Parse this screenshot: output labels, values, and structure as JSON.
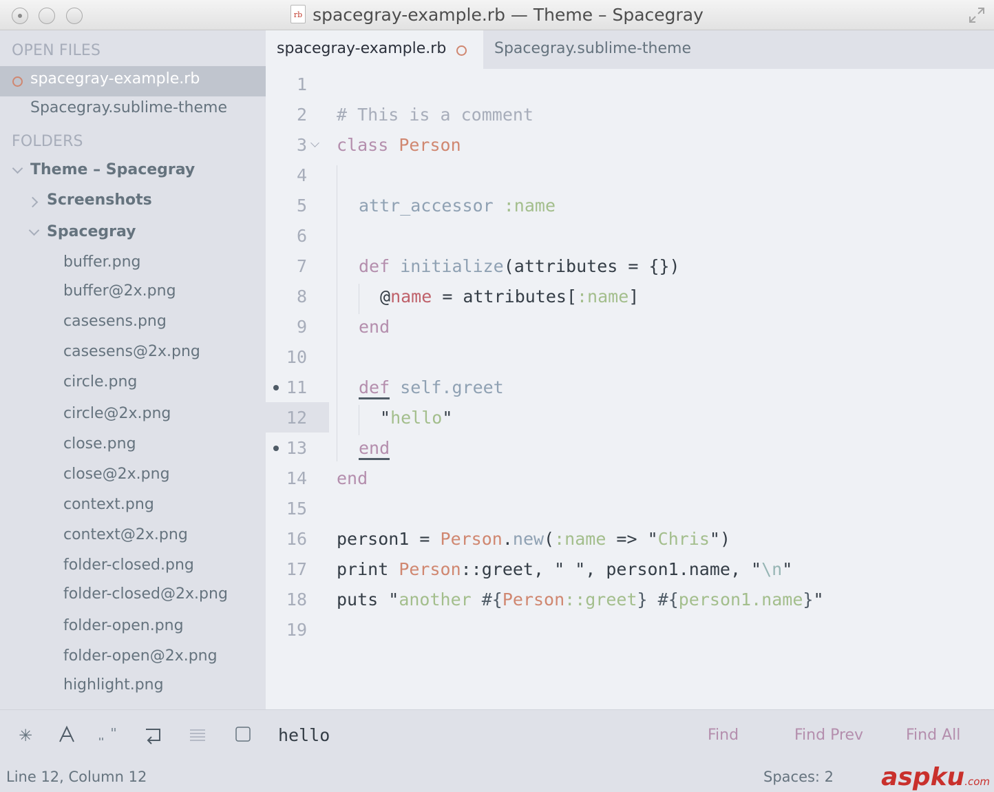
{
  "window": {
    "title": "spacegray-example.rb — Theme – Spacegray",
    "file_icon_label": "rb"
  },
  "sidebar": {
    "open_files_title": "OPEN FILES",
    "open_files": [
      {
        "label": "spacegray-example.rb",
        "active": true,
        "modified": true
      },
      {
        "label": "Spacegray.sublime-theme",
        "active": false,
        "modified": false
      }
    ],
    "folders_title": "FOLDERS",
    "tree": {
      "root": "Theme – Spacegray",
      "screenshots": "Screenshots",
      "spacegray": "Spacegray",
      "files": [
        "buffer.png",
        "buffer@2x.png",
        "casesens.png",
        "casesens@2x.png",
        "circle.png",
        "circle@2x.png",
        "close.png",
        "close@2x.png",
        "context.png",
        "context@2x.png",
        "folder-closed.png",
        "folder-closed@2x.png",
        "folder-open.png",
        "folder-open@2x.png",
        "highlight.png"
      ]
    }
  },
  "tabs": [
    {
      "label": "spacegray-example.rb",
      "active": true,
      "modified": true
    },
    {
      "label": "Spacegray.sublime-theme",
      "active": false,
      "modified": false
    }
  ],
  "editor": {
    "line_numbers": [
      "1",
      "2",
      "3",
      "4",
      "5",
      "6",
      "7",
      "8",
      "9",
      "10",
      "11",
      "12",
      "13",
      "14",
      "15",
      "16",
      "17",
      "18",
      "19"
    ],
    "current_line": 12,
    "comment": "# This is a comment",
    "class_kw": "class",
    "class_name": "Person",
    "attr_accessor": "attr_accessor",
    "sym_name": ":name",
    "def_kw": "def",
    "initialize": "initialize",
    "init_args": "(attributes = {})",
    "ivar_at": "@",
    "ivar_name": "name",
    "assign": " = attributes[",
    "close_bracket": "]",
    "end_kw": "end",
    "self_greet": "self.greet",
    "quote": "\"",
    "hello": "hello",
    "person1_assign": "person1 = ",
    "dot": ".",
    "new": "new",
    "open_paren": "(",
    "arrow": " => ",
    "chris": "Chris",
    "close_paren": "\")",
    "print_kw": "print ",
    "greet_call": "::greet, \" \", person1.name, \"",
    "newline_esc": "\\n",
    "puts_kw": "puts \"",
    "another": "another ",
    "interp_open": "#{",
    "interp_close": "}",
    "greet_sym": "::greet",
    "space": " ",
    "person1_name": "person1.name"
  },
  "find": {
    "query": "hello",
    "buttons": [
      "Find",
      "Find Prev",
      "Find All"
    ]
  },
  "status": {
    "position": "Line 12, Column 12",
    "indent": "Spaces: 2"
  },
  "watermark": {
    "main": "aspku",
    "suffix": ".com"
  }
}
